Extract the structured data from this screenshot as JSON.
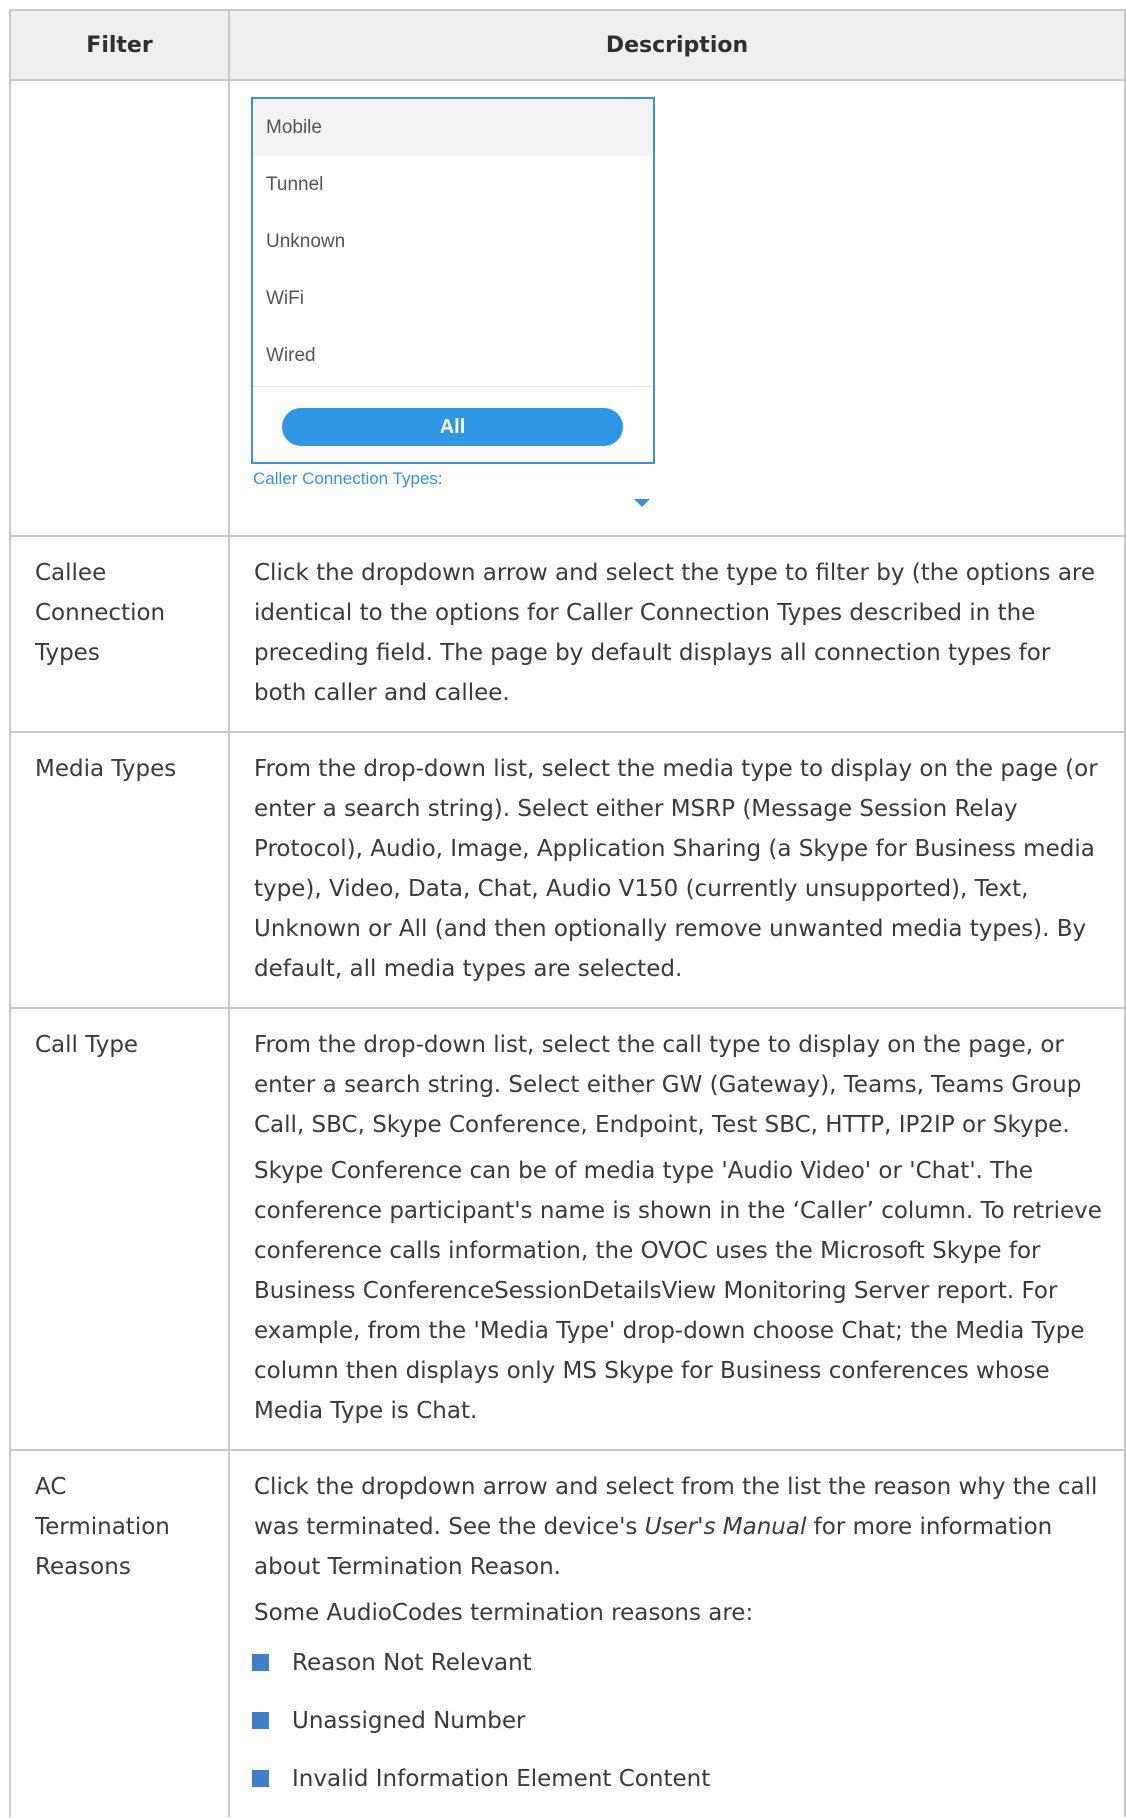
{
  "table": {
    "headers": {
      "filter": "Filter",
      "description": "Description"
    }
  },
  "dropdown": {
    "options": [
      "Mobile",
      "Tunnel",
      "Unknown",
      "WiFi",
      "Wired"
    ],
    "all_button": "All",
    "label": "Caller Connection Types:",
    "accent_color": "#2f96e6"
  },
  "rows": {
    "callee": {
      "filter": "Callee Connection Types",
      "desc": "Click the dropdown arrow and select the type to filter by (the options are identical to the options for Caller Connection Types described in the preceding field. The page by default displays all connection types for both caller and callee."
    },
    "media": {
      "filter": "Media Types",
      "desc": "From the drop-down list, select the media type to display on the page (or enter a search string). Select either MSRP (Message Session Relay Protocol), Audio, Image, Application Sharing (a Skype for Business media type), Video, Data, Chat, Audio V150 (currently unsupported), Text, Unknown or All (and then optionally remove unwanted media types). By default, all media types are selected."
    },
    "call_type": {
      "filter": "Call Type",
      "desc1": "From the drop-down list, select the call type to display on the page, or enter a search string. Select either GW (Gateway), Teams, Teams Group Call, SBC, Skype Conference, Endpoint, Test SBC, HTTP, IP2IP or Skype.",
      "desc2": "Skype Conference can be of media type 'Audio Video' or 'Chat'. The conference participant's name is shown in the ‘Caller’ column. To retrieve conference calls information, the OVOC uses the Microsoft Skype for Business ConferenceSessionDetailsView Monitoring Server report. For example, from the 'Media Type' drop-down choose Chat; the Media Type column then displays only MS Skype for Business conferences whose Media Type is Chat."
    },
    "ac_term": {
      "filter_line1": "AC",
      "filter_line2": "Termination",
      "filter_line3": "Reasons",
      "desc_pre": "Click the dropdown arrow and select from the list the reason why the call was terminated. See the device's ",
      "desc_em": "User's Manual",
      "desc_post": " for more information about Termination Reason.",
      "intro": "Some AudioCodes termination reasons are:",
      "bullets": [
        "Reason Not Relevant",
        "Unassigned Number",
        "Invalid Information Element Content"
      ],
      "bullet_color": "#3e7fc7"
    }
  }
}
